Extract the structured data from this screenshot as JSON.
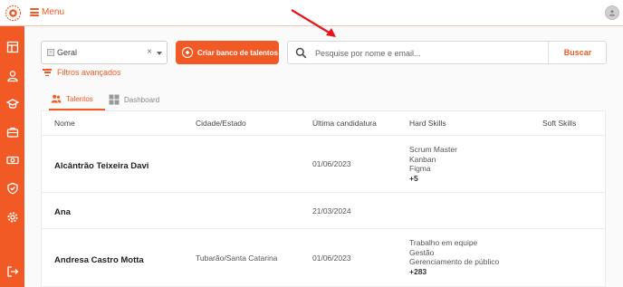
{
  "topbar": {
    "menu_label": "Menu"
  },
  "sidebar": {
    "items": [
      {
        "icon": "dashboard-icon"
      },
      {
        "icon": "users-icon"
      },
      {
        "icon": "graduation-cap-icon"
      },
      {
        "icon": "briefcase-icon"
      },
      {
        "icon": "cash-icon"
      },
      {
        "icon": "shield-check-icon"
      },
      {
        "icon": "gear-icon"
      },
      {
        "icon": "logout-icon"
      }
    ]
  },
  "toolbar": {
    "select_value": "Geral",
    "clear_symbol": "×",
    "create_label": "Criar banco de talentos",
    "search_placeholder": "Pesquise por nome e email...",
    "search_button": "Buscar",
    "filters_label": "Filtros avançados"
  },
  "tabs": [
    {
      "label": "Talentos",
      "active": true
    },
    {
      "label": "Dashboard",
      "active": false
    }
  ],
  "table": {
    "headers": [
      "Nome",
      "Cidade/Estado",
      "Última candidatura",
      "Hard Skills",
      "Soft Skills"
    ],
    "rows": [
      {
        "name": "Alcântrão Teixeira Davi",
        "city": "",
        "last": "01/06/2023",
        "skills": [
          "Scrum Master",
          "Kanban",
          "Figma"
        ],
        "more": "+5"
      },
      {
        "name": "Ana",
        "city": "",
        "last": "21/03/2024",
        "skills": [],
        "more": ""
      },
      {
        "name": "Andresa Castro Motta",
        "city": "Tubarão/Santa Catarina",
        "last": "01/06/2023",
        "skills": [
          "Trabalho em equipe",
          "Gestão",
          "Gerenciamento de público"
        ],
        "more": "+283"
      }
    ]
  },
  "colors": {
    "accent": "#f15a24",
    "annotation": "#e8141b"
  }
}
